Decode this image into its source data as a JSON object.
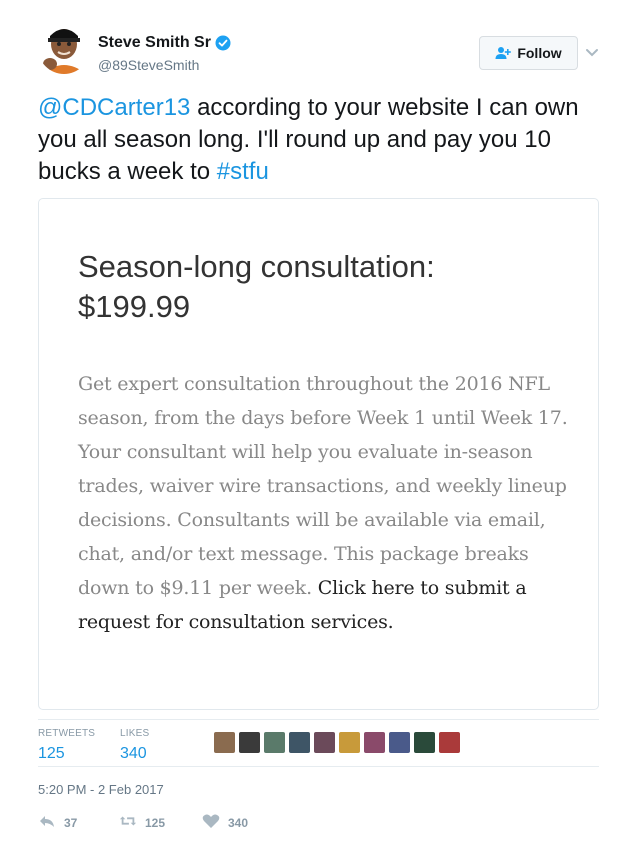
{
  "user": {
    "name": "Steve Smith Sr",
    "handle": "@89SteveSmith",
    "verified_icon": "verified-badge-icon"
  },
  "follow_button": {
    "label": "Follow",
    "icon": "follow-person-plus-icon"
  },
  "more_menu": {
    "icon": "chevron-down-icon"
  },
  "tweet": {
    "mention": "@CDCarter13",
    "text_part1": " according to your website  I can own you all season long. I'll round up and pay you 10 bucks a week to ",
    "hashtag": "#stfu"
  },
  "card": {
    "title_line1": "Season-long consultation:",
    "title_line2": "$199.99",
    "body": "Get expert consultation throughout the 2016 NFL season, from the days before Week 1 until Week 17. Your consultant will help you evaluate in-season trades, waiver wire transactions, and weekly lineup decisions. Consultants will be available via email, chat, and/or text message. This package breaks down to $9.11 per week. ",
    "cta": "Click here to submit a request for consultation services."
  },
  "stats": {
    "retweets_label": "RETWEETS",
    "retweets_value": "125",
    "likes_label": "LIKES",
    "likes_value": "340"
  },
  "likers": [
    {
      "icon": "liker-avatar-1",
      "color": "#8a6b4f"
    },
    {
      "icon": "liker-avatar-2",
      "color": "#3a3a3a"
    },
    {
      "icon": "liker-avatar-3",
      "color": "#5a7a6a"
    },
    {
      "icon": "liker-avatar-4",
      "color": "#3e5566"
    },
    {
      "icon": "liker-avatar-5",
      "color": "#6b4a5a"
    },
    {
      "icon": "liker-avatar-6",
      "color": "#c89a3a"
    },
    {
      "icon": "liker-avatar-7",
      "color": "#8a4a6a"
    },
    {
      "icon": "liker-avatar-8",
      "color": "#4a5a8a"
    },
    {
      "icon": "liker-avatar-9",
      "color": "#2a4a3a"
    },
    {
      "icon": "liker-avatar-10",
      "color": "#aa3a3a"
    }
  ],
  "timestamp": "5:20 PM - 2 Feb 2017",
  "actions": {
    "reply_count": "37",
    "retweet_count": "125",
    "like_count": "340"
  },
  "colors": {
    "accent": "#1b95e0",
    "muted": "#8899a6"
  }
}
